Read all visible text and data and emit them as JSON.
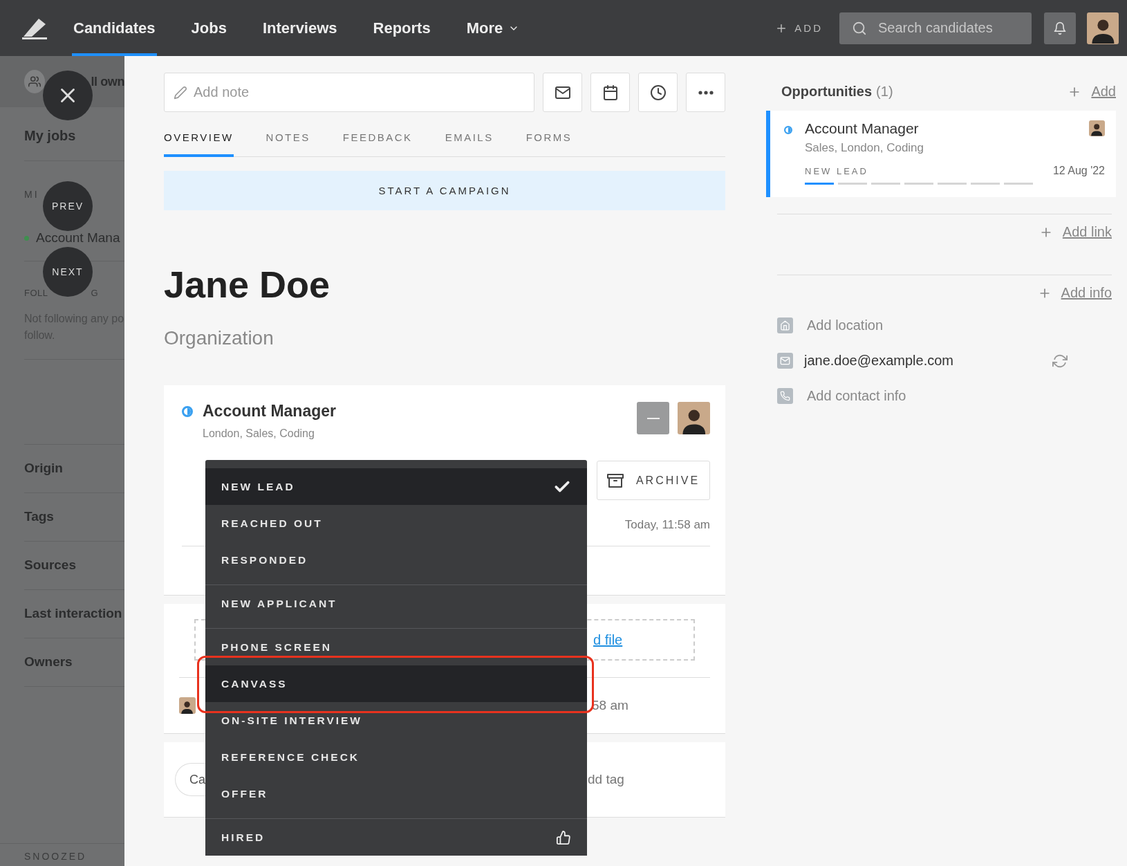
{
  "topbar": {
    "nav": [
      {
        "label": "Candidates",
        "selected": true,
        "kind": "link"
      },
      {
        "label": "Jobs",
        "selected": false,
        "kind": "link"
      },
      {
        "label": "Interviews",
        "selected": false,
        "kind": "link"
      },
      {
        "label": "Reports",
        "selected": false,
        "kind": "link"
      },
      {
        "label": "More",
        "selected": false,
        "kind": "menu"
      }
    ],
    "add": "ADD",
    "search": {
      "placeholder": "Search candidates"
    }
  },
  "sidebar": {
    "header": "ll own",
    "my_jobs": "My jobs",
    "mine_heading": "MI",
    "mine_items": [
      "Account Mana"
    ],
    "following_heading": [
      "FOLL",
      "G"
    ],
    "following_empty": [
      "Not following any po",
      "follow."
    ],
    "filters": [
      "Origin",
      "Tags",
      "Sources",
      "Last interaction",
      "Owners"
    ],
    "snoozed": "SNOOZED"
  },
  "floating_buttons": [
    {
      "kind": "close"
    },
    {
      "kind": "prev",
      "label": "PREV"
    },
    {
      "kind": "next",
      "label": "NEXT"
    }
  ],
  "note": {
    "placeholder": "Add note"
  },
  "tabs": [
    {
      "label": "OVERVIEW",
      "selected": true
    },
    {
      "label": "NOTES",
      "selected": false
    },
    {
      "label": "FEEDBACK",
      "selected": false
    },
    {
      "label": "EMAILS",
      "selected": false
    },
    {
      "label": "FORMS",
      "selected": false
    }
  ],
  "campaign_button": "START A CAMPAIGN",
  "candidate": {
    "name": "Jane Doe",
    "organization": "Organization"
  },
  "opportunity_card": {
    "title": "Account Manager",
    "tags": "London, Sales, Coding",
    "archive": "ARCHIVE",
    "timestamp": "Today, 11:58 am"
  },
  "stage_menu": [
    {
      "label": "NEW LEAD",
      "selected": true,
      "highlighted": false,
      "annotated": false,
      "divider_before": false,
      "kind": "stage"
    },
    {
      "label": "REACHED OUT",
      "selected": false,
      "highlighted": false,
      "annotated": false,
      "divider_before": false,
      "kind": "stage"
    },
    {
      "label": "RESPONDED",
      "selected": false,
      "highlighted": false,
      "annotated": false,
      "divider_before": false,
      "kind": "stage"
    },
    {
      "label": "NEW APPLICANT",
      "selected": false,
      "highlighted": false,
      "annotated": false,
      "divider_before": true,
      "kind": "stage"
    },
    {
      "label": "PHONE SCREEN",
      "selected": false,
      "highlighted": false,
      "annotated": false,
      "divider_before": true,
      "kind": "stage"
    },
    {
      "label": "CANVASS",
      "selected": false,
      "highlighted": true,
      "annotated": true,
      "divider_before": false,
      "kind": "stage"
    },
    {
      "label": "ON-SITE INTERVIEW",
      "selected": false,
      "highlighted": false,
      "annotated": false,
      "divider_before": false,
      "kind": "stage"
    },
    {
      "label": "REFERENCE CHECK",
      "selected": false,
      "highlighted": false,
      "annotated": false,
      "divider_before": false,
      "kind": "stage"
    },
    {
      "label": "OFFER",
      "selected": false,
      "highlighted": false,
      "annotated": false,
      "divider_before": false,
      "kind": "stage"
    },
    {
      "label": "HIRED",
      "selected": false,
      "highlighted": false,
      "annotated": false,
      "divider_before": true,
      "kind": "hired"
    }
  ],
  "files": {
    "link": "d file"
  },
  "activity": {
    "time": "58 am"
  },
  "tags": {
    "chip": "Ca",
    "add": "dd tag"
  },
  "right": {
    "opportunities": {
      "title": "Opportunities",
      "count": "(1)",
      "add": "Add"
    },
    "opportunity": {
      "title": "Account Manager",
      "tags": "Sales, London, Coding",
      "stage": "NEW LEAD",
      "date": "12 Aug '22",
      "segments": [
        {
          "filled": true
        },
        {
          "filled": false
        },
        {
          "filled": false
        },
        {
          "filled": false
        },
        {
          "filled": false
        },
        {
          "filled": false
        },
        {
          "filled": false
        }
      ]
    },
    "add_link": "Add link",
    "add_info": "Add info",
    "contacts": [
      {
        "kind": "location",
        "text": "Add location",
        "empty": true
      },
      {
        "kind": "email",
        "text": "jane.doe@example.com",
        "empty": false
      },
      {
        "kind": "phone",
        "text": "Add contact info",
        "empty": true
      }
    ]
  }
}
